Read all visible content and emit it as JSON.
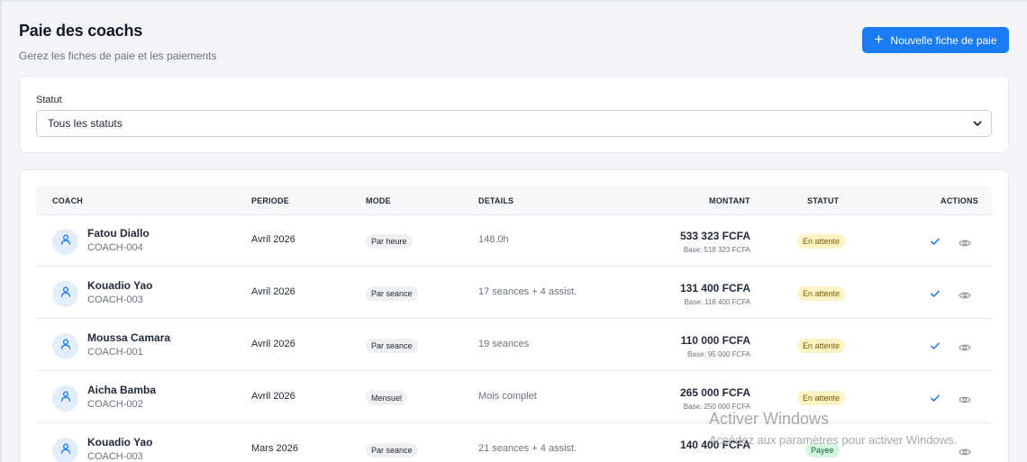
{
  "header": {
    "title": "Paie des coachs",
    "subtitle": "Gerez les fiches de paie et les paiements",
    "new_button_label": "Nouvelle fiche de paie"
  },
  "filter": {
    "label": "Statut",
    "selected": "Tous les statuts"
  },
  "table": {
    "columns": {
      "coach": "COACH",
      "periode": "PERIODE",
      "mode": "MODE",
      "details": "DETAILS",
      "montant": "MONTANT",
      "statut": "STATUT",
      "actions": "ACTIONS"
    },
    "rows": [
      {
        "name": "Fatou Diallo",
        "code": "COACH-004",
        "periode": "Avril 2026",
        "mode": "Par heure",
        "details": "148.0h",
        "montant": "533 323 FCFA",
        "base": "Base: 518 323 FCFA",
        "statut": "En attente",
        "statut_kind": "pending"
      },
      {
        "name": "Kouadio Yao",
        "code": "COACH-003",
        "periode": "Avril 2026",
        "mode": "Par seance",
        "details": "17 seances + 4 assist.",
        "montant": "131 400 FCFA",
        "base": "Base: 116 400 FCFA",
        "statut": "En attente",
        "statut_kind": "pending"
      },
      {
        "name": "Moussa Camara",
        "code": "COACH-001",
        "periode": "Avril 2026",
        "mode": "Par seance",
        "details": "19 seances",
        "montant": "110 000 FCFA",
        "base": "Base: 95 000 FCFA",
        "statut": "En attente",
        "statut_kind": "pending"
      },
      {
        "name": "Aicha Bamba",
        "code": "COACH-002",
        "periode": "Avril 2026",
        "mode": "Mensuel",
        "details": "Mois complet",
        "montant": "265 000 FCFA",
        "base": "Base: 250 000 FCFA",
        "statut": "En attente",
        "statut_kind": "pending"
      },
      {
        "name": "Kouadio Yao",
        "code": "COACH-003",
        "periode": "Mars 2026",
        "mode": "Par seance",
        "details": "21 seances + 4 assist.",
        "montant": "140 400 FCFA",
        "base": "",
        "statut": "Payee",
        "statut_kind": "paid"
      }
    ]
  },
  "watermark": {
    "title": "Activer Windows",
    "subtitle": "Accédez aux paramètres pour activer Windows."
  },
  "icons": {
    "new_button": "plus-icon",
    "select": "chevron-down-icon",
    "avatar": "user-icon",
    "approve": "check-icon",
    "view": "eye-icon"
  },
  "colors": {
    "primary": "#1a7cf2",
    "pending_bg": "#fdf3c4",
    "paid_bg": "#d6f5df",
    "page_bg": "#f3f5f8"
  }
}
